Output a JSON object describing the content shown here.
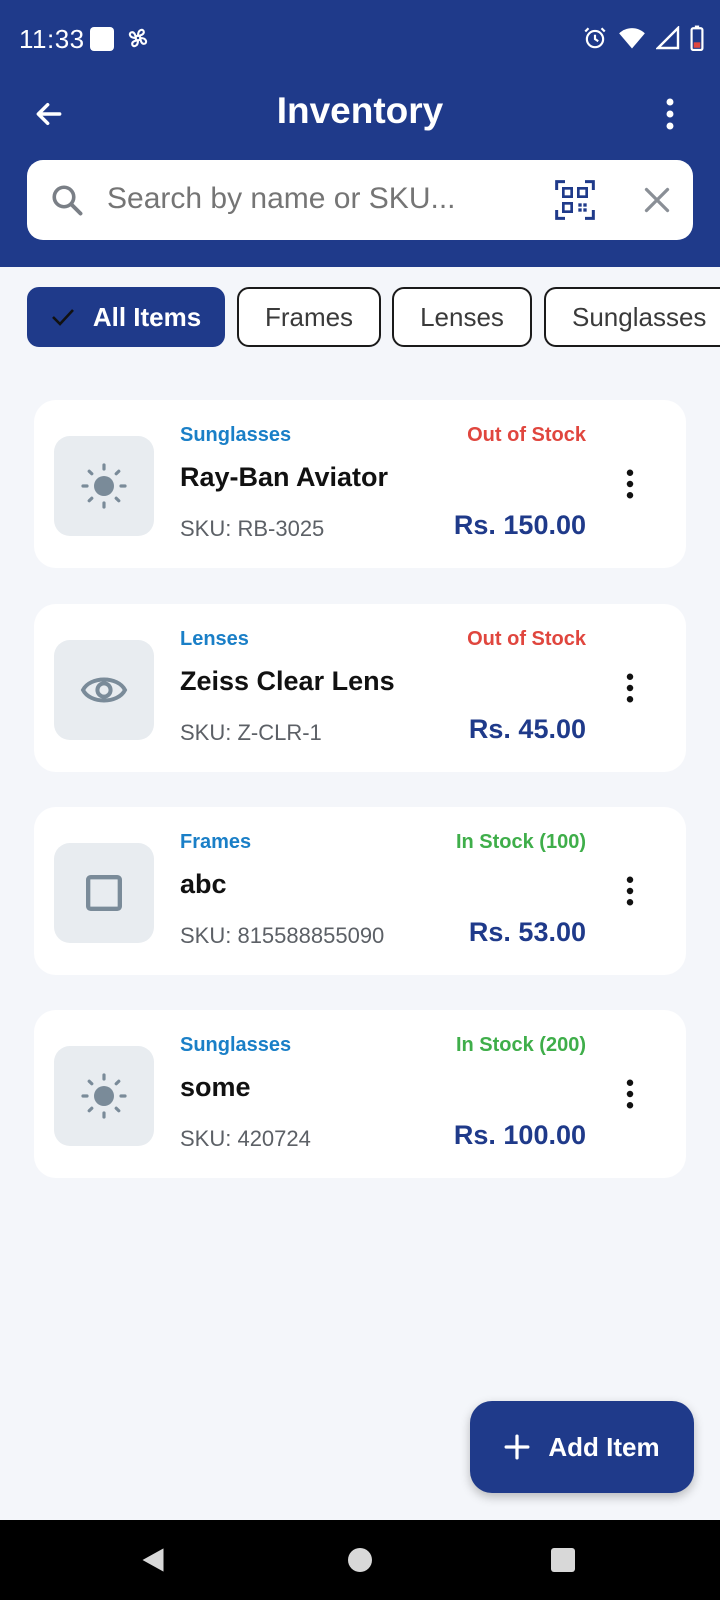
{
  "status": {
    "time": "11:33"
  },
  "header": {
    "title": "Inventory"
  },
  "search": {
    "placeholder": "Search by name or SKU..."
  },
  "filters": [
    {
      "label": "All Items",
      "selected": true
    },
    {
      "label": "Frames",
      "selected": false
    },
    {
      "label": "Lenses",
      "selected": false
    },
    {
      "label": "Sunglasses",
      "selected": false
    }
  ],
  "items": [
    {
      "category": "Sunglasses",
      "stock": "Out of Stock",
      "stock_status": "out",
      "name": "Ray-Ban Aviator",
      "sku": "SKU: RB-3025",
      "price": "Rs. 150.00",
      "icon": "sun-icon"
    },
    {
      "category": "Lenses",
      "stock": "Out of Stock",
      "stock_status": "out",
      "name": "Zeiss Clear Lens",
      "sku": "SKU: Z-CLR-1",
      "price": "Rs. 45.00",
      "icon": "eye-icon"
    },
    {
      "category": "Frames",
      "stock": "In Stock (100)",
      "stock_status": "in",
      "name": "abc",
      "sku": "SKU: 815588855090",
      "price": "Rs. 53.00",
      "icon": "square-frame-icon"
    },
    {
      "category": "Sunglasses",
      "stock": "In Stock (200)",
      "stock_status": "in",
      "name": "some",
      "sku": "SKU: 420724",
      "price": "Rs. 100.00",
      "icon": "sun-icon"
    }
  ],
  "fab": {
    "label": "Add Item"
  },
  "colors": {
    "primary": "#1f3a8a",
    "out_of_stock": "#e0463e",
    "in_stock": "#3fae4a",
    "category": "#1a7fc7"
  }
}
